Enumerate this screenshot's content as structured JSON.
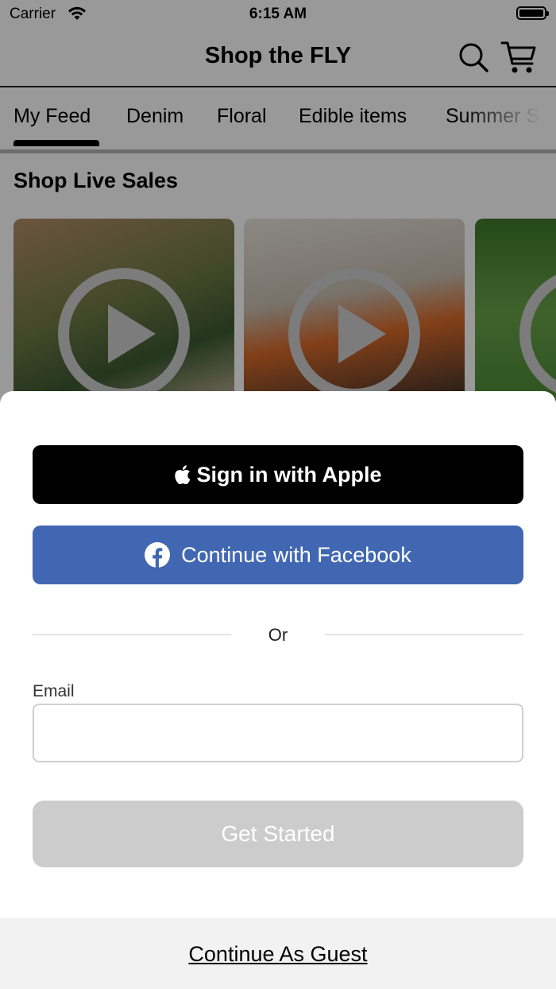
{
  "status_bar": {
    "carrier": "Carrier",
    "time": "6:15 AM"
  },
  "header": {
    "title": "Shop the FLY",
    "search_icon": "search-icon",
    "cart_icon": "cart-icon"
  },
  "tabs": [
    {
      "label": "My Feed",
      "active": true
    },
    {
      "label": "Denim"
    },
    {
      "label": "Floral"
    },
    {
      "label": "Edible items"
    },
    {
      "label": "Summer S"
    }
  ],
  "section": {
    "title": "Shop Live Sales"
  },
  "sheet": {
    "apple_label": "Sign in with Apple",
    "facebook_label": "Continue with Facebook",
    "or_text": "Or",
    "email_label": "Email",
    "email_value": "",
    "get_started_label": "Get Started",
    "guest_label": "Continue As Guest"
  },
  "colors": {
    "facebook_blue": "#4267b2",
    "apple_black": "#000000",
    "disabled_button": "#cccccc",
    "guest_bar_bg": "#f2f2f2"
  }
}
